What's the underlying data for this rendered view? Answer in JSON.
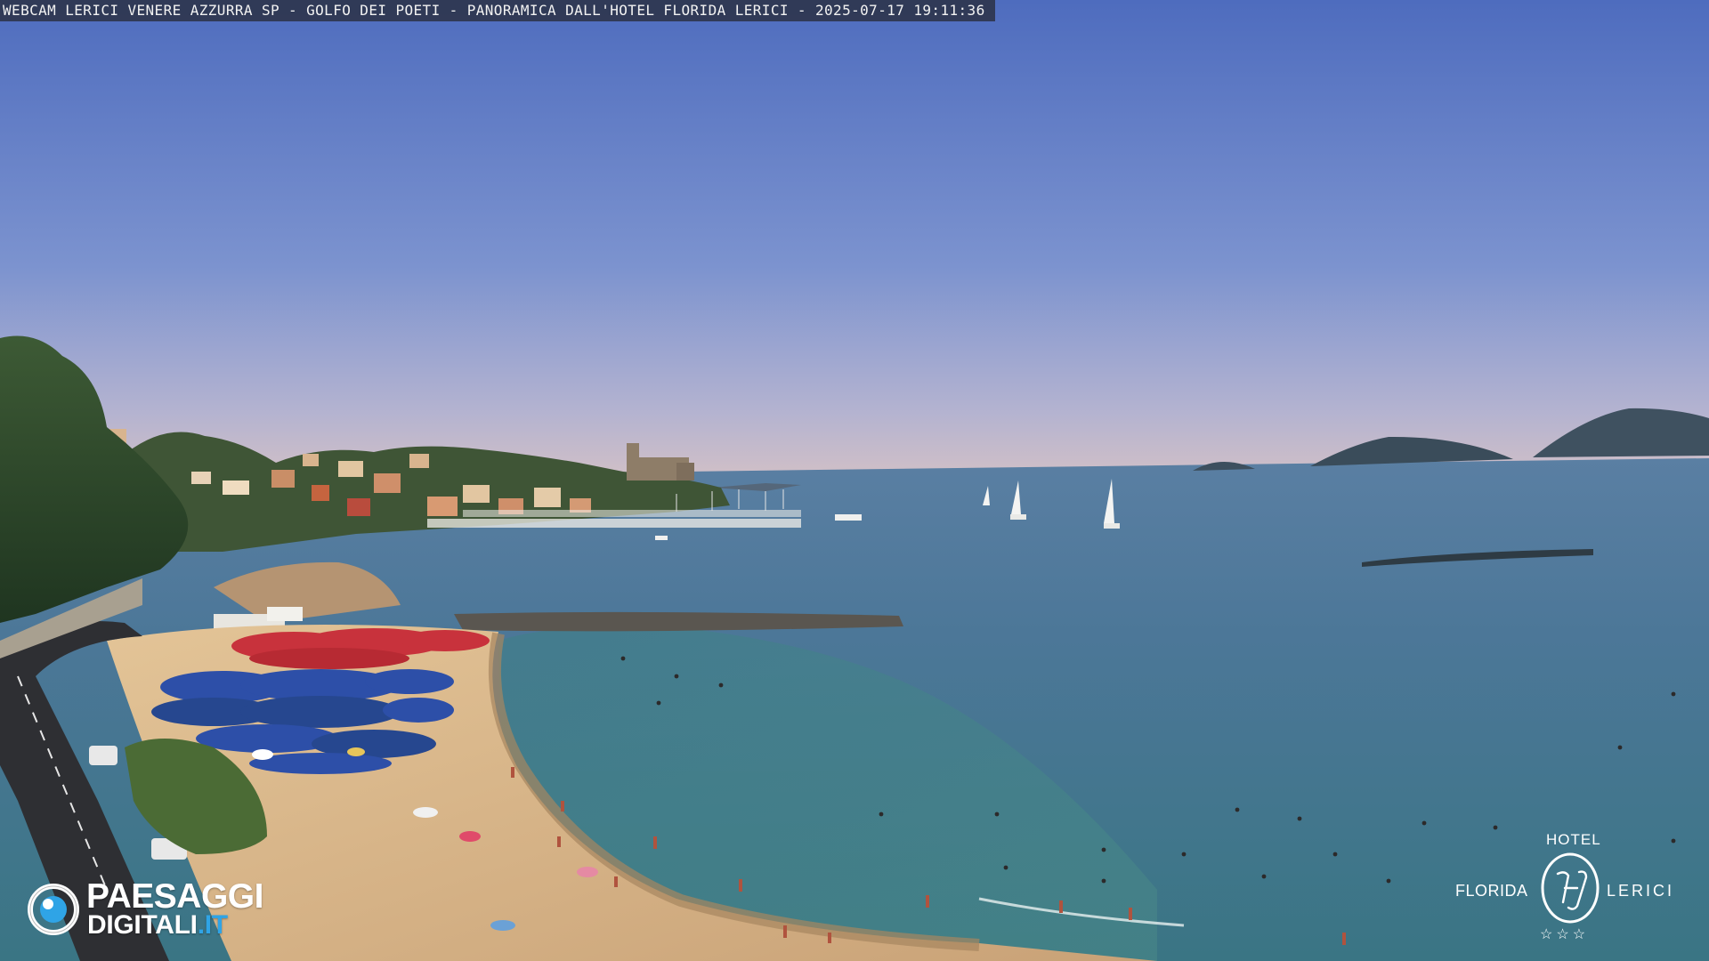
{
  "caption": {
    "text": "WEBCAM LERICI VENERE AZZURRA SP - GOLFO DEI POETI - PANORAMICA DALL'HOTEL FLORIDA LERICI - 2025-07-17 19:11:36"
  },
  "logo_left": {
    "line1": "PAESAGGI",
    "line2_main": "DIGITALI",
    "line2_accent": ".IT",
    "accent_color": "#2fa4e6"
  },
  "logo_right": {
    "hotel": "HOTEL",
    "name_left": "FLORIDA",
    "name_right": "LERICI",
    "stars": "☆☆☆",
    "monogram": "HF"
  },
  "colors": {
    "sky_top": "#5574c2",
    "sky_horizon": "#c9b9c4",
    "sea_far": "#4f7a9c",
    "sea_near": "#3d7a86",
    "sand": "#d9b98c",
    "vegetation": "#2f4a2a",
    "umbrella_blue": "#2d4fa8",
    "umbrella_red": "#c8323c"
  }
}
